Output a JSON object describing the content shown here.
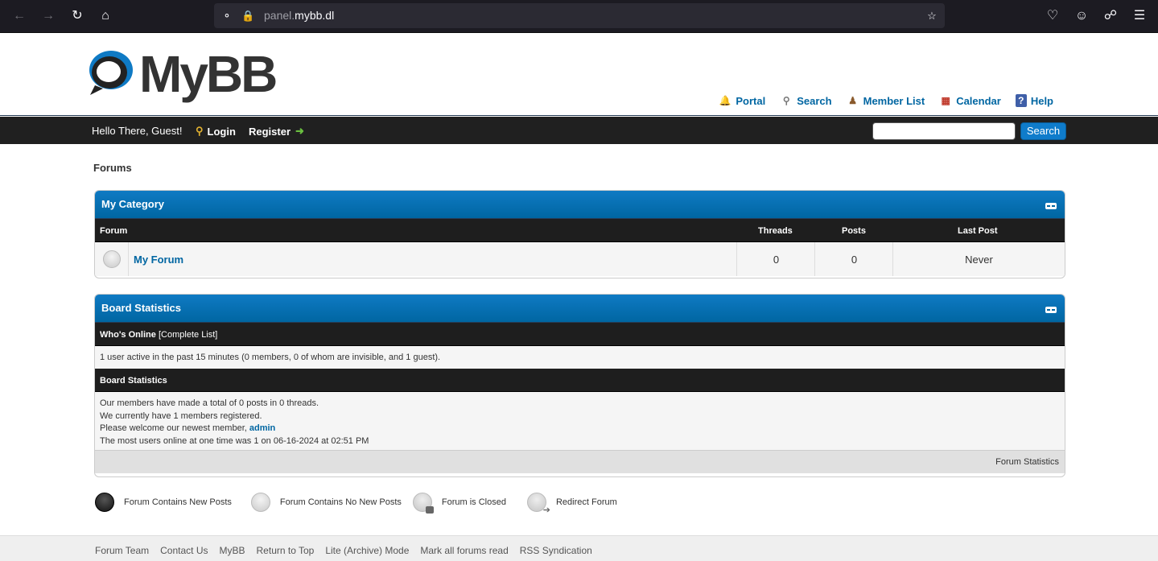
{
  "browser": {
    "url_prefix": "panel.",
    "url_domain": "mybb.dl",
    "back_icon": "back-arrow-icon",
    "forward_icon": "forward-arrow-icon",
    "reload_icon": "reload-icon",
    "home_icon": "home-icon"
  },
  "header": {
    "logo_text": "MyBB",
    "menu": [
      {
        "label": "Portal",
        "icon": "bell-icon"
      },
      {
        "label": "Search",
        "icon": "magnifier-icon"
      },
      {
        "label": "Member List",
        "icon": "members-icon"
      },
      {
        "label": "Calendar",
        "icon": "calendar-icon"
      },
      {
        "label": "Help",
        "icon": "help-icon"
      }
    ]
  },
  "panel": {
    "welcome": "Hello There, Guest!",
    "login": "Login",
    "register": "Register",
    "search_button": "Search",
    "search_placeholder": ""
  },
  "breadcrumb": "Forums",
  "category": {
    "title": "My Category",
    "columns": {
      "forum": "Forum",
      "threads": "Threads",
      "posts": "Posts",
      "last_post": "Last Post"
    },
    "forums": [
      {
        "name": "My Forum",
        "threads": "0",
        "posts": "0",
        "last_post": "Never"
      }
    ]
  },
  "stats": {
    "title": "Board Statistics",
    "whos_online_label": "Who's Online",
    "complete_list": "[Complete List]",
    "online_text": "1 user active in the past 15 minutes (0 members, 0 of whom are invisible, and 1 guest).",
    "stats_header": "Board Statistics",
    "line1": "Our members have made a total of 0 posts in 0 threads.",
    "line2": "We currently have 1 members registered.",
    "line3_prefix": "Please welcome our newest member,",
    "newest_member": "admin",
    "line4": "The most users online at one time was 1 on 06-16-2024 at 02:51 PM",
    "footer_link": "Forum Statistics"
  },
  "legend": [
    {
      "label": "Forum Contains New Posts"
    },
    {
      "label": "Forum Contains No New Posts"
    },
    {
      "label": "Forum is Closed"
    },
    {
      "label": "Redirect Forum"
    }
  ],
  "footer": {
    "links": [
      "Forum Team",
      "Contact Us",
      "MyBB",
      "Return to Top",
      "Lite (Archive) Mode",
      "Mark all forums read",
      "RSS Syndication"
    ]
  }
}
